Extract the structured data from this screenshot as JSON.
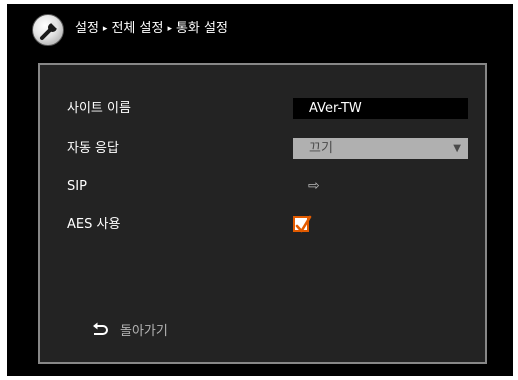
{
  "header": {
    "icon": "wrench-icon",
    "breadcrumb": [
      "설정",
      "전체 설정",
      "통화 설정"
    ],
    "separator": "▸"
  },
  "settings": {
    "site_name": {
      "label": "사이트 이름",
      "value": "AVer-TW"
    },
    "auto_answer": {
      "label": "자동 응답",
      "value": "끄기",
      "arrow": "▼"
    },
    "sip": {
      "label": "SIP",
      "arrow": "⇨"
    },
    "aes": {
      "label": "AES 사용",
      "checked": true
    }
  },
  "back": {
    "icon": "back-arrow-icon",
    "label": "돌아가기"
  },
  "colors": {
    "accent": "#e25b00",
    "panel_bg": "#232323",
    "panel_border": "#878787",
    "dropdown_bg": "#b0b0b0"
  }
}
